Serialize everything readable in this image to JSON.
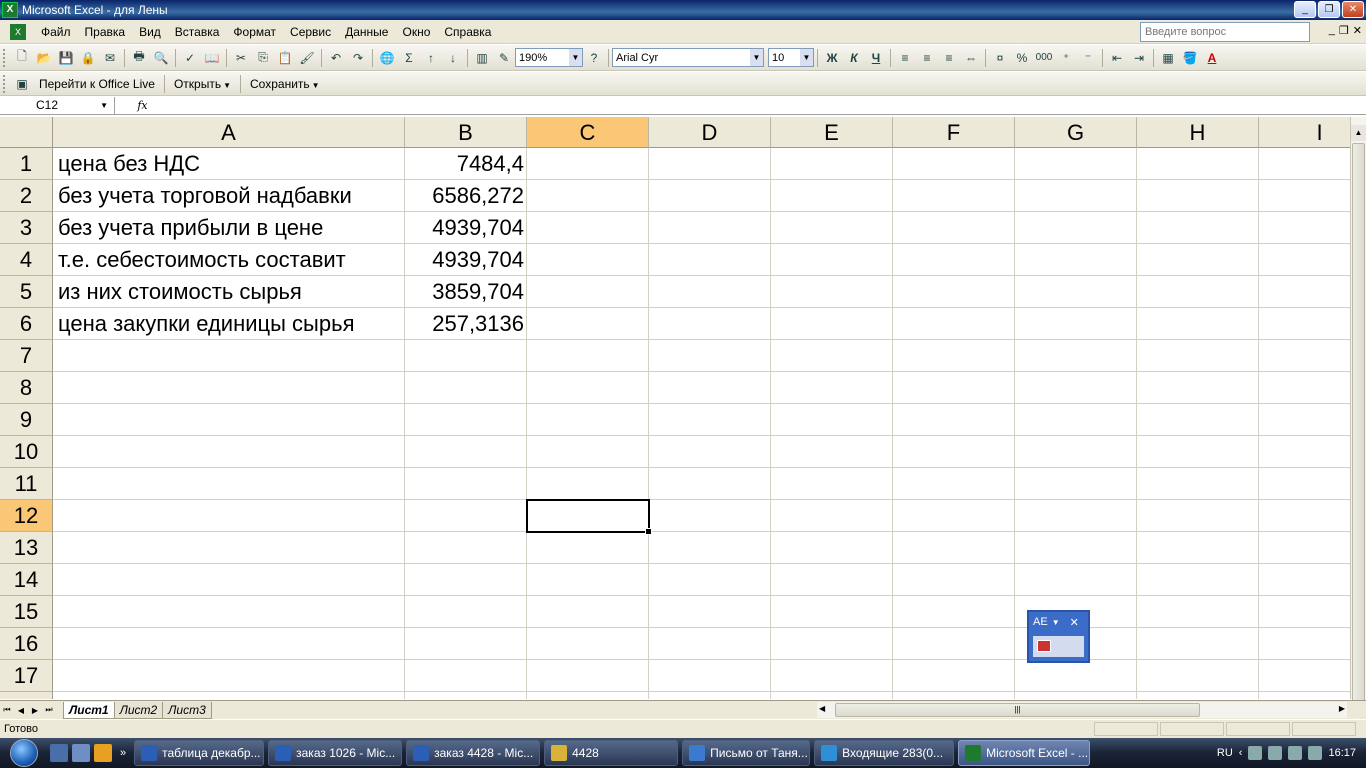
{
  "window": {
    "title": "Microsoft Excel - для Лены"
  },
  "menu": {
    "items": [
      "Файл",
      "Правка",
      "Вид",
      "Вставка",
      "Формат",
      "Сервис",
      "Данные",
      "Окно",
      "Справка"
    ],
    "question_placeholder": "Введите вопрос"
  },
  "toolbar": {
    "zoom": "190%",
    "font_name": "Arial Cyr",
    "font_size": "10",
    "bold_label": "Ж",
    "italic_label": "К",
    "underline_label": "Ч",
    "percent_label": "%",
    "thousands_label": "000",
    "font_color_label": "A"
  },
  "office_toolbar": {
    "goto_label": "Перейти к Office Live",
    "open_label": "Открыть",
    "save_label": "Сохранить"
  },
  "formula_bar": {
    "name_box": "C12",
    "fx": "fx",
    "formula": ""
  },
  "sheet": {
    "columns": [
      "A",
      "B",
      "C",
      "D",
      "E",
      "F",
      "G",
      "H",
      "I"
    ],
    "active_column": "C",
    "rows": [
      "1",
      "2",
      "3",
      "4",
      "5",
      "6",
      "7",
      "8",
      "9",
      "10",
      "11",
      "12",
      "13",
      "14",
      "15",
      "16",
      "17"
    ],
    "active_row": "12",
    "data": [
      {
        "a": "цена без НДС",
        "b": "7484,4"
      },
      {
        "a": "без учета торговой надбавки",
        "b": "6586,272"
      },
      {
        "a": "без учета прибыли в цене",
        "b": "4939,704"
      },
      {
        "a": "т.е. себестоимость составит",
        "b": "4939,704"
      },
      {
        "a": "из них стоимость сырья",
        "b": "3859,704"
      },
      {
        "a": "цена закупки единицы сырья",
        "b": "257,3136"
      }
    ]
  },
  "smart_tag": {
    "label": "AE"
  },
  "tabs": [
    "Лист1",
    "Лист2",
    "Лист3"
  ],
  "status": {
    "text": "Готово"
  },
  "taskbar": {
    "tasks": [
      {
        "label": "таблица декабр...",
        "color": "#2b5fb5"
      },
      {
        "label": "заказ 1026 - Mic...",
        "color": "#2b5fb5"
      },
      {
        "label": "заказ 4428 - Mic...",
        "color": "#2b5fb5"
      },
      {
        "label": "4428",
        "color": "#d9b23a"
      },
      {
        "label": "Письмо от Таня...",
        "color": "#3b7ad0"
      },
      {
        "label": "Входящие 283(0...",
        "color": "#2f8fd6"
      },
      {
        "label": "Microsoft Excel - ...",
        "color": "#1d7a2e"
      }
    ],
    "lang": "RU",
    "time": "16:17"
  }
}
